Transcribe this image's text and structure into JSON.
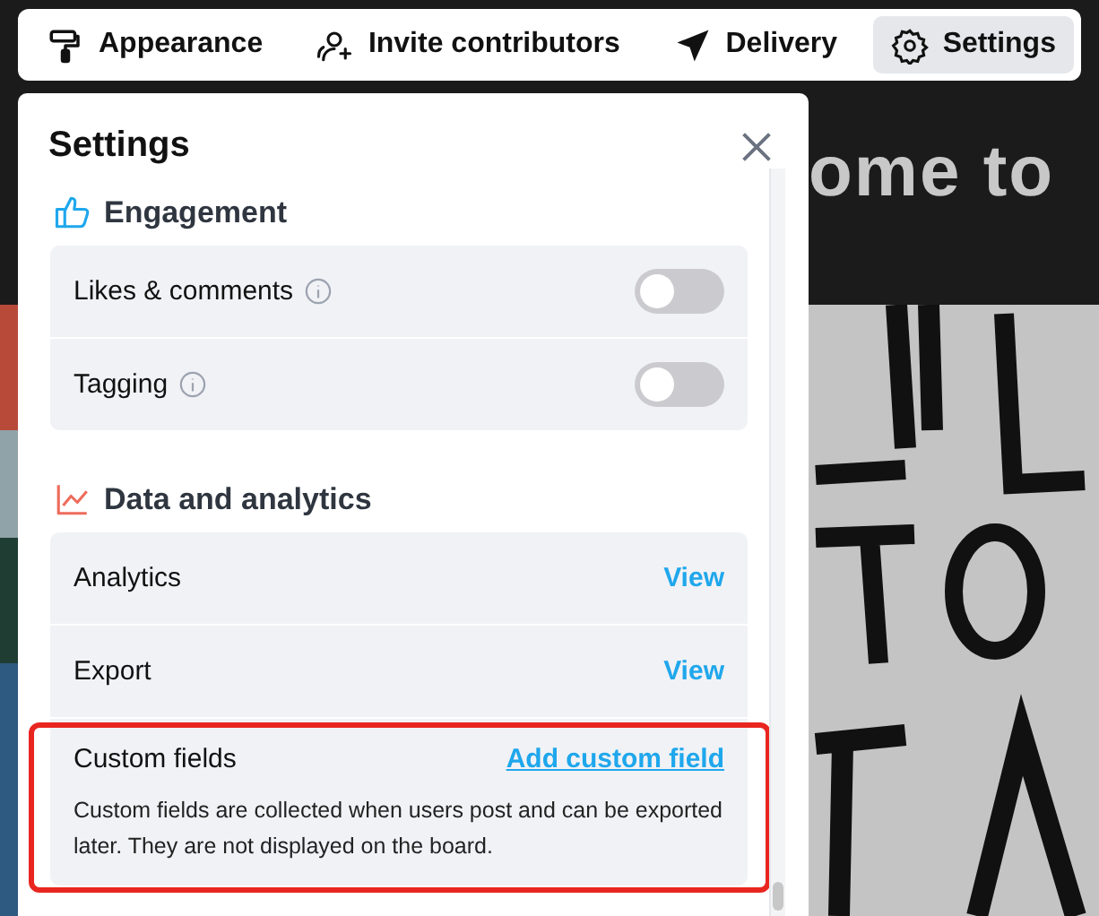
{
  "nav": {
    "items": [
      {
        "label": "Appearance",
        "selected": false
      },
      {
        "label": "Invite contributors",
        "selected": false
      },
      {
        "label": "Delivery",
        "selected": false
      },
      {
        "label": "Settings",
        "selected": true
      }
    ]
  },
  "board": {
    "heading": "ome to"
  },
  "panel": {
    "title": "Settings",
    "sections": [
      {
        "title": "Engagement",
        "rows": [
          {
            "kind": "toggle",
            "label": "Likes & comments",
            "info": true,
            "on": false
          },
          {
            "kind": "toggle",
            "label": "Tagging",
            "info": true,
            "on": false
          }
        ]
      },
      {
        "title": "Data and analytics",
        "rows": [
          {
            "kind": "link",
            "label": "Analytics",
            "action": "View"
          },
          {
            "kind": "link",
            "label": "Export",
            "action": "View"
          },
          {
            "kind": "note",
            "label": "Custom fields",
            "action": "Add custom field",
            "description": "Custom fields are collected when users post and can be exported later. They are not displayed on the board.",
            "highlighted": true
          }
        ]
      }
    ]
  }
}
